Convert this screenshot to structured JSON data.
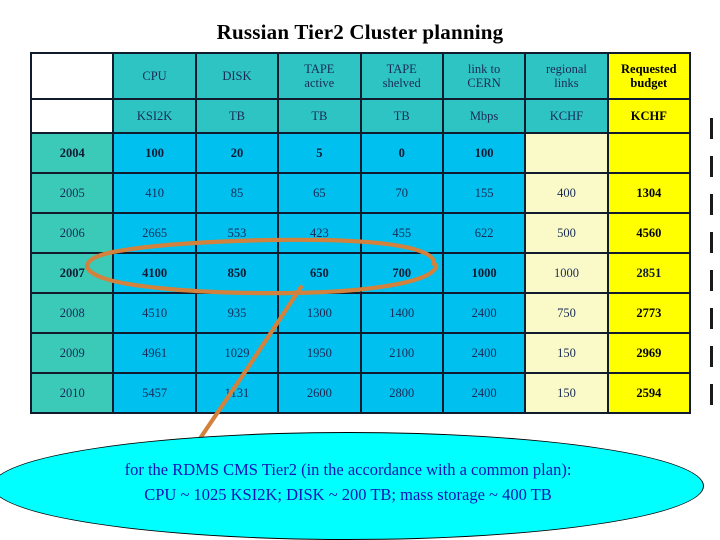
{
  "slide": {
    "title": "Russian Tier2 Cluster planning",
    "background": "#ffffff"
  },
  "colors": {
    "header_teal": "#2ec4c4",
    "year_teal": "#3bc9b8",
    "data_cyan": "#00c0f0",
    "regional_light_yellow": "#fafac8",
    "budget_yellow": "#ffff00",
    "annotation_orange": "#d2823c",
    "callout_cyan": "#00ffff",
    "callout_text_blue": "#1414b4",
    "grid_line": "#101c2e"
  },
  "table": {
    "corner_label": "",
    "headers": [
      "CPU",
      "DISK",
      "TAPE active",
      "TAPE shelved",
      "link to CERN",
      "regional links",
      "Requested budget"
    ],
    "header_lines": [
      [
        "CPU",
        ""
      ],
      [
        "DISK",
        ""
      ],
      [
        "TAPE",
        "active"
      ],
      [
        "TAPE",
        "shelved"
      ],
      [
        "link to",
        "CERN"
      ],
      [
        "regional",
        "links"
      ],
      [
        "Requested",
        "budget"
      ]
    ],
    "units": [
      "KSI2K",
      "TB",
      "TB",
      "TB",
      "Mbps",
      "KCHF",
      "KCHF"
    ],
    "rows": [
      {
        "year": "2004",
        "emphasis": true,
        "values": [
          "100",
          "20",
          "5",
          "0",
          "100",
          "",
          ""
        ]
      },
      {
        "year": "2005",
        "emphasis": false,
        "values": [
          "410",
          "85",
          "65",
          "70",
          "155",
          "400",
          "1304"
        ]
      },
      {
        "year": "2006",
        "emphasis": false,
        "values": [
          "2665",
          "553",
          "423",
          "455",
          "622",
          "500",
          "4560"
        ]
      },
      {
        "year": "2007",
        "emphasis": true,
        "values": [
          "4100",
          "850",
          "650",
          "700",
          "1000",
          "1000",
          "2851"
        ]
      },
      {
        "year": "2008",
        "emphasis": false,
        "values": [
          "4510",
          "935",
          "1300",
          "1400",
          "2400",
          "750",
          "2773"
        ]
      },
      {
        "year": "2009",
        "emphasis": false,
        "values": [
          "4961",
          "1029",
          "1950",
          "2100",
          "2400",
          "150",
          "2969"
        ]
      },
      {
        "year": "2010",
        "emphasis": false,
        "values": [
          "5457",
          "1131",
          "2600",
          "2800",
          "2400",
          "150",
          "2594"
        ]
      }
    ]
  },
  "annotation": {
    "type": "hand-drawn-ellipse-with-tail",
    "highlights_row_year": "2007",
    "color": "#d2823c"
  },
  "callout": {
    "line1": "for the  RDMS CMS Tier2 (in the accordance with a common plan):",
    "line2": "CPU ~ 1025 KSI2K; DISK ~ 200 TB; mass storage ~ 400 TB"
  }
}
